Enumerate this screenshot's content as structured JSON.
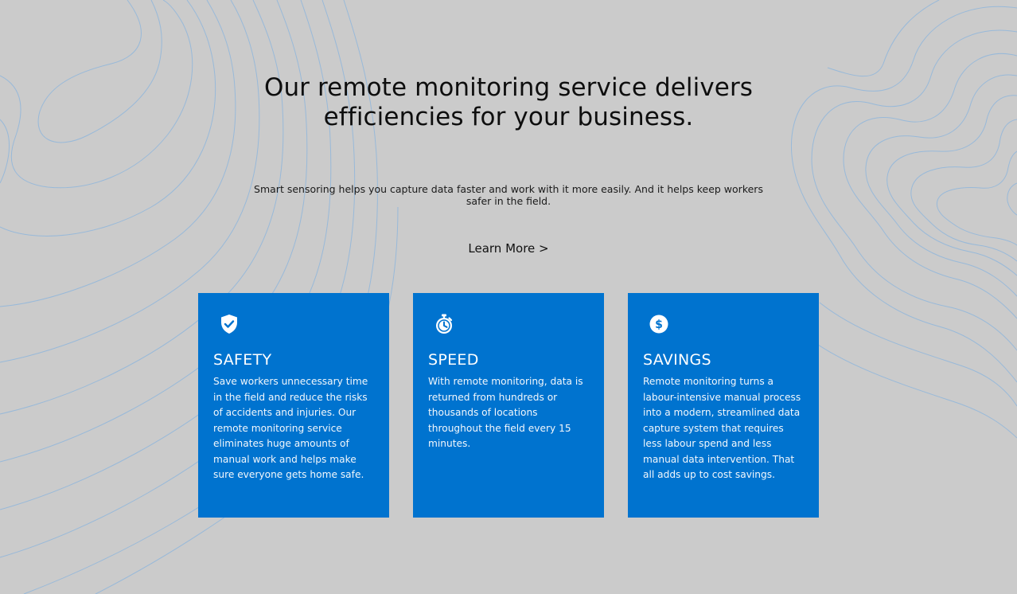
{
  "hero": {
    "headline_line1": "Our remote monitoring service delivers",
    "headline_line2": "efficiencies for your business.",
    "subtext": "Smart sensoring helps you capture data faster and work with it more easily. And it helps keep workers safer in the field.",
    "learn_more_label": "Learn More >"
  },
  "colors": {
    "background": "#cbcbcb",
    "card_blue": "#0073cf",
    "contour_line": "#8fb6dc"
  },
  "cards": [
    {
      "icon": "shield-check-icon",
      "title": "SAFETY",
      "body": "Save workers unnecessary time in the field and reduce the risks of accidents and injuries. Our remote monitoring service eliminates huge amounts of manual work and helps make sure everyone gets home safe."
    },
    {
      "icon": "stopwatch-icon",
      "title": "SPEED",
      "body": "With remote monitoring, data is returned from hundreds or thousands of locations throughout the field every 15 minutes."
    },
    {
      "icon": "dollar-coin-icon",
      "title": "SAVINGS",
      "body": "Remote monitoring turns a labour-intensive manual process into a modern, streamlined data capture system that requires less labour spend and less manual data intervention. That all adds up to cost savings."
    }
  ]
}
